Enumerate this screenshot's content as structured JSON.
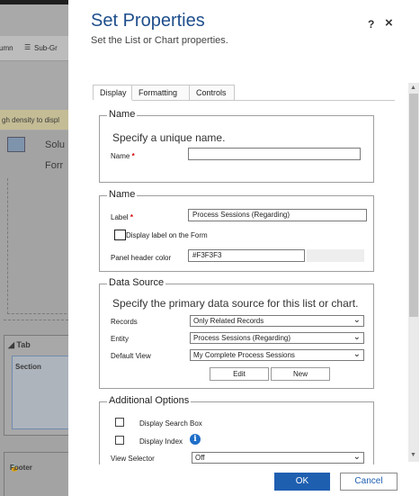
{
  "background": {
    "toolbar": {
      "column_label": "umn",
      "subgrid_label": "Sub-Gr"
    },
    "warning_text": "gh density to displ",
    "solution_label": "Solu",
    "form_label": "Forr",
    "tab_label": "Tab",
    "section_label": "Section",
    "footer_label": "Footer"
  },
  "dialog": {
    "title": "Set Properties",
    "subtitle": "Set the List or Chart properties.",
    "help_label": "?",
    "close_label": "×",
    "tabs": [
      {
        "label": "Display"
      },
      {
        "label": "Formatting"
      },
      {
        "label": "Controls"
      }
    ],
    "name_group": {
      "legend": "Name",
      "description": "Specify a unique name.",
      "name_label": "Name",
      "required_mark": "*",
      "name_value": ""
    },
    "label_group": {
      "legend": "Name",
      "label_label": "Label",
      "required_mark": "*",
      "label_value": "Process Sessions (Regarding)",
      "display_label_text": "Display label on the Form",
      "display_label_checked": false,
      "panel_header_color_label": "Panel header color",
      "panel_header_color_value": "#F3F3F3"
    },
    "data_source": {
      "legend": "Data Source",
      "description": "Specify the primary data source for this list or chart.",
      "records_label": "Records",
      "records_value": "Only Related Records",
      "entity_label": "Entity",
      "entity_value": "Process Sessions (Regarding)",
      "default_view_label": "Default View",
      "default_view_value": "My Complete Process Sessions",
      "edit_label": "Edit",
      "new_label": "New"
    },
    "additional_options": {
      "legend": "Additional Options",
      "display_search_box_label": "Display Search Box",
      "display_search_box_checked": false,
      "display_index_label": "Display Index",
      "display_index_checked": false,
      "info_icon": "i",
      "view_selector_label": "View Selector",
      "view_selector_value": "Off"
    },
    "footer": {
      "ok_label": "OK",
      "cancel_label": "Cancel"
    }
  },
  "colors": {
    "accent": "#1f5fb0",
    "title": "#1e4e8c",
    "required": "#d20000"
  }
}
